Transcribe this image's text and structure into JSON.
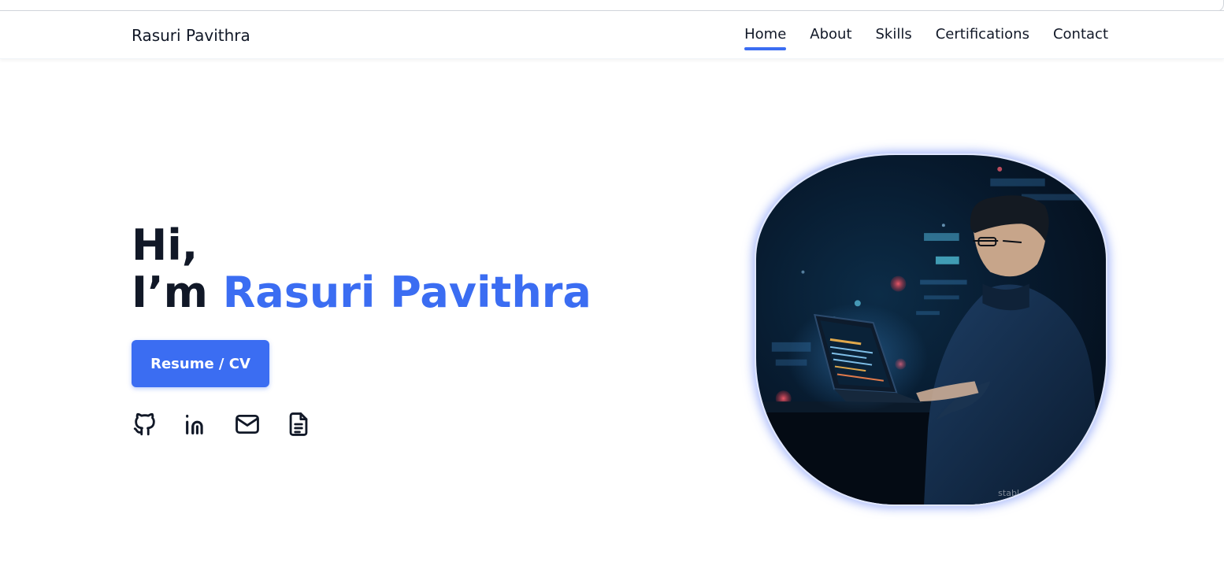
{
  "brand": "Rasuri Pavithra",
  "nav": {
    "items": [
      {
        "label": "Home",
        "active": true
      },
      {
        "label": "About",
        "active": false
      },
      {
        "label": "Skills",
        "active": false
      },
      {
        "label": "Certifications",
        "active": false
      },
      {
        "label": "Contact",
        "active": false
      }
    ]
  },
  "hero": {
    "greeting": "Hi,",
    "intro_prefix": "I’m",
    "name": "Rasuri Pavithra",
    "cv_button_label": "Resume / CV"
  },
  "socials": [
    {
      "icon": "github-icon"
    },
    {
      "icon": "linkedin-icon"
    },
    {
      "icon": "mail-icon"
    },
    {
      "icon": "document-icon"
    }
  ],
  "portrait": {
    "subject": "person coding at laptop in dark room",
    "watermark": "stabl"
  },
  "colors": {
    "accent": "#3b6df2",
    "text": "#111827",
    "background": "#ffffff"
  }
}
